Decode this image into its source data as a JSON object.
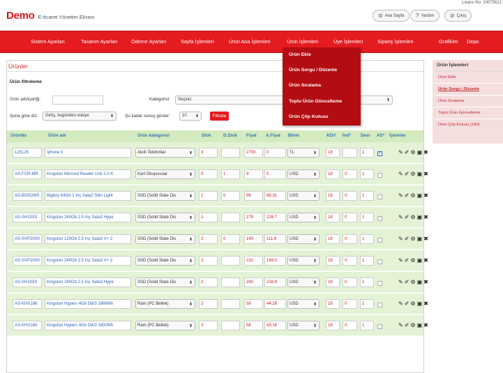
{
  "header": {
    "license": "Lisans No: 10075612",
    "brand": "Demo",
    "subtitle": "E-ticaret Yönetim Ekranı",
    "buttons": [
      {
        "label": "Ana Sayfa",
        "icon": "home-icon"
      },
      {
        "label": "Yardım",
        "icon": "help-icon"
      },
      {
        "label": "Çıkış",
        "icon": "logout-icon"
      }
    ]
  },
  "nav": {
    "items": [
      "Sistem Ayarları",
      "Tasarım Ayarları",
      "Ödeme Ayarları",
      "Sayfa İşlemleri",
      "Ürün Ana İşlemleri",
      "Ürün İşlemleri",
      "Üye İşlemleri",
      "Sipariş İşlemleri",
      "Grafikler",
      "Depo"
    ],
    "active": "Ürün İşlemleri"
  },
  "dropdown": {
    "items": [
      "Ürün Ekle",
      "Ürün Sorgu / Düzenle",
      "Ürün Sıralama",
      "Toplu Ürün Güncelleme",
      "Ürün Çöp Kutusu"
    ]
  },
  "page": {
    "title": "Ürünler",
    "filter_title": "Ürün filtreleme",
    "name_label": "Ürün adı/içeriği:",
    "name_value": "",
    "category_label": "Kategorisi:",
    "category_value": "Seçiniz",
    "sort_label": "Şuna göre diz:",
    "sort_value": "Girtiş, bugünden eskiye",
    "count_label": "Şu kadar sonuç göster:",
    "count_value": "10",
    "filter_button": "Filtrele"
  },
  "table": {
    "headers": [
      "ÜrünNo",
      "Ürün adı",
      "Ürün kategorisi",
      "Stok",
      "D.Stok",
      "Fiyat",
      "A.Fiyat",
      "Birim",
      "KDV",
      "İnd*",
      "Desi",
      "AS*",
      "İşlemler"
    ],
    "rows": [
      {
        "no": "125125",
        "name": "Iphone 5",
        "category": "Akıllı Telefonlar",
        "stock": "3",
        "dstock": "",
        "price": "2700",
        "aprice": "0",
        "unit": "TL",
        "kdv": "18",
        "ind": "",
        "desi": "1",
        "as": true
      },
      {
        "no": "AS-FCR-MR",
        "name": "Kingston Microsd Reader Usb 2.0 K",
        "category": "Kart Okuyucular",
        "stock": "0",
        "dstock": "1",
        "price": "9",
        "aprice": "5",
        "unit": "USD",
        "kdv": "18",
        "ind": "0",
        "desi": "1",
        "as": false
      },
      {
        "no": "AS-BSSOMS",
        "name": "Bigboy 64Gb 1 Inç Sata2 Slim Light",
        "category": "SSD (Solid State Dis",
        "stock": "1",
        "dstock": "0",
        "price": "99",
        "aprice": "68.31",
        "unit": "USD",
        "kdv": "18",
        "ind": "0",
        "desi": "1",
        "as": false
      },
      {
        "no": "AS-SH103S",
        "name": "Kingston 240Gb 2.5 Inç Sata3 Hype",
        "category": "SSD (Solid State Dis",
        "stock": "1",
        "dstock": "",
        "price": "279",
        "aprice": "228.7",
        "unit": "USD",
        "kdv": "18",
        "ind": "0",
        "desi": "1",
        "as": false
      },
      {
        "no": "AS-SVP200S",
        "name": "Kingston 120Gb 2.5 Inç Sata3 V+ 2",
        "category": "SSD (Solid State Dis",
        "stock": "2",
        "dstock": "0",
        "price": "149",
        "aprice": "111.8",
        "unit": "USD",
        "kdv": "18",
        "ind": "0",
        "desi": "1",
        "as": false
      },
      {
        "no": "AS-SVP200S",
        "name": "Kingston 240Gb 2.5 Inç Sata3 V+ 2",
        "category": "SSD (Solid State Dis",
        "stock": "2",
        "dstock": "",
        "price": "231",
        "aprice": "194.0",
        "unit": "USD",
        "kdv": "18",
        "ind": "0",
        "desi": "1",
        "as": false
      },
      {
        "no": "AS-SH103S",
        "name": "Kingston 240Gb 2.5 Inç Sata3 Hype",
        "category": "SSD (Solid State Dis",
        "stock": "2",
        "dstock": "",
        "price": "260",
        "aprice": "216.8",
        "unit": "USD",
        "kdv": "18",
        "ind": "0",
        "desi": "1",
        "as": false
      },
      {
        "no": "AS-KHX186",
        "name": "Kingston Hypers 4Gb Ddr3 1866Mh",
        "category": "Ram (PC Bellek)",
        "stock": "2",
        "dstock": "",
        "price": "58",
        "aprice": "44.28",
        "unit": "USD",
        "kdv": "18",
        "ind": "0",
        "desi": "1",
        "as": false
      },
      {
        "no": "AS-KHX160",
        "name": "Kingston Hypers 4Gb Ddr3 1600Mh",
        "category": "Ram (PC Bellek)",
        "stock": "3",
        "dstock": "",
        "price": "58",
        "aprice": "43.16",
        "unit": "USD",
        "kdv": "18",
        "ind": "0",
        "desi": "1",
        "as": false
      }
    ]
  },
  "sidebar": {
    "title": "Ürün İşlemleri",
    "items": [
      "Ürün Ekle",
      "Ürün Sorgu / Düzenle",
      "Ürün Sıralama",
      "Toplu Ürün Güncelleme",
      "Ürün Çöp Kutusu (180)"
    ],
    "active_index": 1
  },
  "colors": {
    "brand_red": "#e41b1f",
    "link_blue": "#2d63b4",
    "row_green": "#e4f2d6",
    "header_green": "#d4ebbf"
  }
}
